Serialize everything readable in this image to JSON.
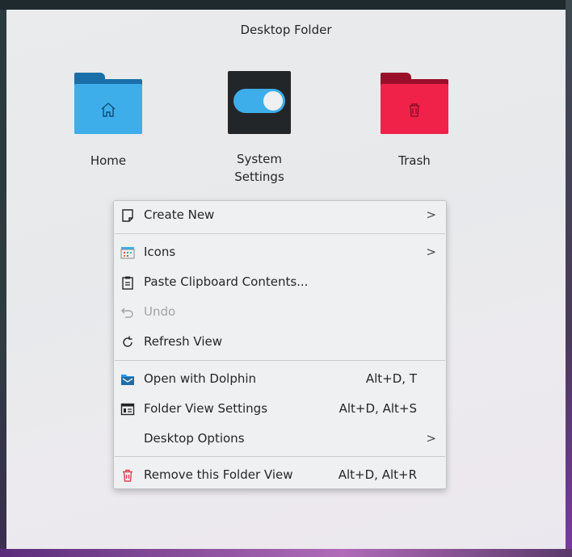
{
  "panel": {
    "title": "Desktop Folder"
  },
  "desktop_icons": [
    {
      "label": "Home",
      "icon": "home-folder-icon",
      "color": "#3daee9"
    },
    {
      "label": "System\nSettings",
      "label_line1": "System",
      "label_line2": "Settings",
      "icon": "settings-toggle-icon",
      "color": "#3daee9"
    },
    {
      "label": "Trash",
      "icon": "trash-folder-icon",
      "color": "#f0224a"
    }
  ],
  "context_menu": {
    "items": [
      {
        "label": "Create New",
        "icon": "new-document-icon",
        "submenu": true
      },
      {
        "label": "Icons",
        "icon": "icon-view-icon",
        "submenu": true
      },
      {
        "label": "Paste Clipboard Contents...",
        "icon": "paste-icon"
      },
      {
        "label": "Undo",
        "icon": "undo-icon",
        "disabled": true
      },
      {
        "label": "Refresh View",
        "icon": "refresh-icon"
      },
      {
        "label": "Open with Dolphin",
        "icon": "dolphin-folder-icon",
        "shortcut": "Alt+D, T"
      },
      {
        "label": "Folder View Settings",
        "icon": "settings-panel-icon",
        "shortcut": "Alt+D, Alt+S"
      },
      {
        "label": "Desktop Options",
        "icon": "",
        "submenu": true
      },
      {
        "label": "Remove this Folder View",
        "icon": "remove-trash-icon",
        "shortcut": "Alt+D, Alt+R"
      }
    ],
    "submenu_arrow": ">"
  },
  "colors": {
    "accent": "#3daee9",
    "danger": "#da4453",
    "menu_bg": "#eff0f1",
    "text": "#232629"
  }
}
